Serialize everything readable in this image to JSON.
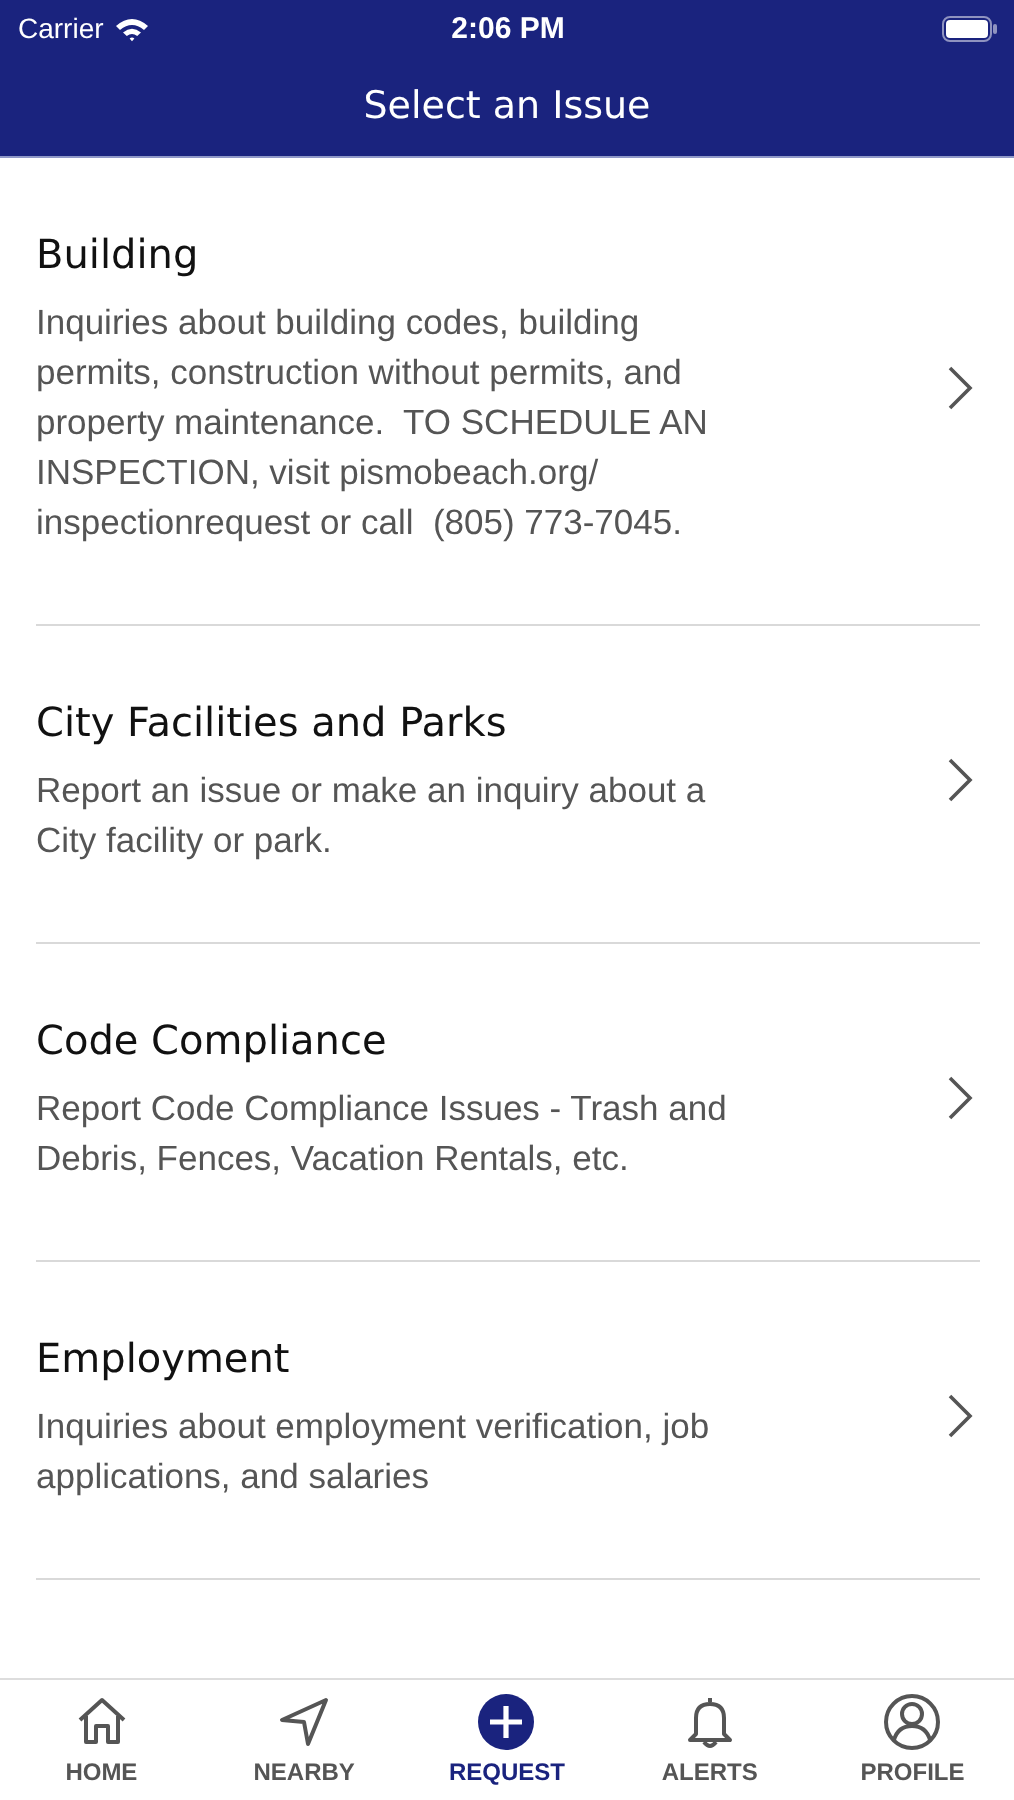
{
  "status_bar": {
    "carrier": "Carrier",
    "time": "2:06 PM"
  },
  "nav_bar": {
    "title": "Select an Issue"
  },
  "issues": [
    {
      "title": "Building",
      "description": "Inquiries about building codes, building permits, construction without permits, and property maintenance.  TO SCHEDULE AN INSPECTION, visit pismobeach.org/ inspectionrequest or call  (805) 773-7045."
    },
    {
      "title": "City Facilities and Parks",
      "description": "Report an issue or make an inquiry about a City facility or park."
    },
    {
      "title": "Code Compliance",
      "description": "Report Code Compliance Issues - Trash and Debris, Fences, Vacation Rentals, etc."
    },
    {
      "title": "Employment",
      "description": "Inquiries about employment verification, job applications, and salaries"
    }
  ],
  "tab_bar": [
    {
      "label": "HOME",
      "selected": false
    },
    {
      "label": "NEARBY",
      "selected": false
    },
    {
      "label": "REQUEST",
      "selected": true
    },
    {
      "label": "ALERTS",
      "selected": false
    },
    {
      "label": "PROFILE",
      "selected": false
    }
  ]
}
